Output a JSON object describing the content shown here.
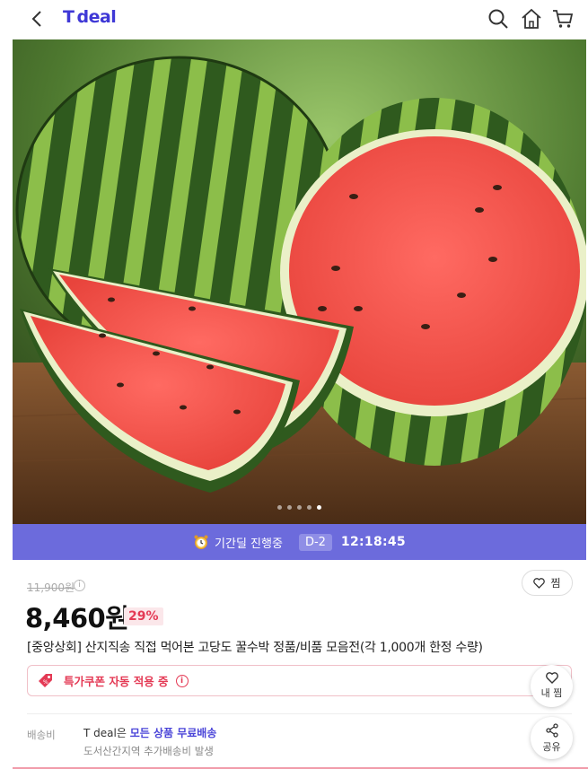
{
  "header": {
    "back_icon": "chevron-left-icon",
    "logo_prefix": "T",
    "logo_text": "deal",
    "logo_color": "#3f38d6",
    "icons": [
      "search-icon",
      "home-icon",
      "cart-icon"
    ]
  },
  "hero": {
    "image_alt": "수박",
    "carousel_dot_count": 5,
    "carousel_active_index": 4
  },
  "banner": {
    "background": "#6c6bdc",
    "label": "기간딜 진행중",
    "d_badge": "D-2",
    "timer": "12:18:45"
  },
  "product": {
    "original_price": "11,900원",
    "price": "8,460원",
    "discount": "29%",
    "title": "[중앙상회] 산지직송 직접 먹어본 고당도 꿀수박 정품/비품 모음전(각 1,000개 한정 수량)",
    "wish_label": "찜"
  },
  "coupon": {
    "text": "특가쿠폰 자동 적용 중",
    "info_symbol": "i"
  },
  "shipping": {
    "label": "배송비",
    "line1_prefix": "T deal은 ",
    "line1_highlight": "모든 상품 무료배송",
    "line2": "도서산간지역 추가배송비 발생"
  },
  "floating": {
    "wish_label": "내 찜",
    "share_label": "공유"
  },
  "colors": {
    "accent_red": "#e43a55",
    "accent_purple": "#4a44d8"
  }
}
